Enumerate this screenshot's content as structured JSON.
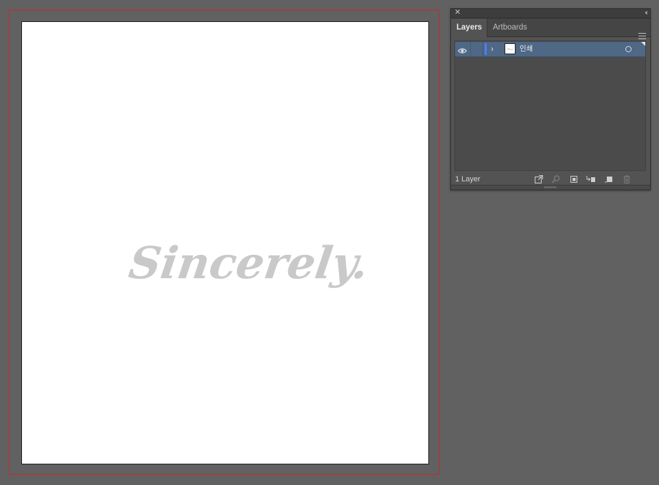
{
  "panel": {
    "close_glyph": "✕",
    "collapse_glyph": "‹‹",
    "tabs": [
      {
        "label": "Layers",
        "active": true
      },
      {
        "label": "Artboards",
        "active": false
      }
    ],
    "menu_icon": "hamburger-icon",
    "layers": [
      {
        "name": "인쇄",
        "visible": true,
        "color": "#4f7cff",
        "expanded": false
      }
    ],
    "footer": {
      "layer_count": "1 Layer",
      "buttons": [
        "export-icon",
        "locate-object-icon",
        "make-clipping-mask-icon",
        "create-sublayer-icon",
        "create-new-layer-icon",
        "delete-icon"
      ]
    }
  },
  "canvas": {
    "bleed_color": "#c8272c",
    "artwork_text": "Sincerely.",
    "artwork_color": "#c9c9c9"
  }
}
